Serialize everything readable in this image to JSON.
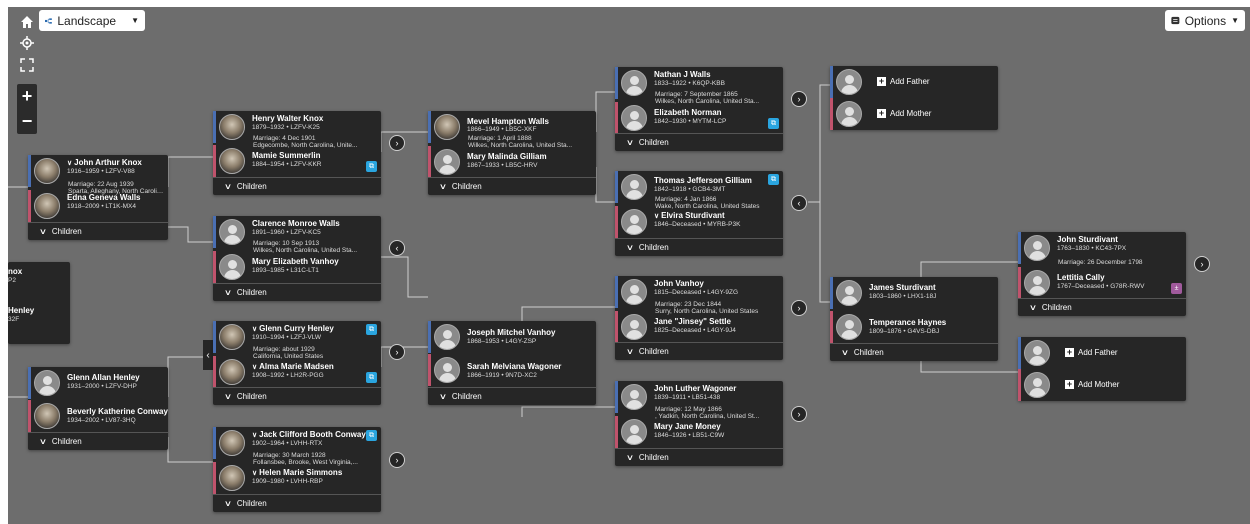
{
  "toolbar": {
    "layout_label": "Landscape",
    "options_label": "Options",
    "home_icon": "home-icon",
    "locate_icon": "crosshair-icon",
    "fullscreen_icon": "fullscreen-icon",
    "zoom_in": "+",
    "zoom_out": "−"
  },
  "common": {
    "children": "Children",
    "add_father": "Add Father",
    "add_mother": "Add Mother"
  },
  "partial": {
    "n1": "nox",
    "n1b": "P2",
    "n2": "Henley",
    "n2b": "32F"
  },
  "fam_knox": {
    "h_name": "John Arthur Knox",
    "h_dates": "1916–1959 • LZFV-V88",
    "marriage": "Marriage: 22 Aug 1939",
    "place": "Sparta, Alleghany, North Carolina,...",
    "w_name": "Edna Geneva Walls",
    "w_dates": "1918–2009 • LT1K-MX4"
  },
  "fam_henley": {
    "h_name": "Glenn Allan Henley",
    "h_dates": "1931–2000 • LZFV-DHP",
    "w_name": "Beverly Katherine Conway",
    "w_dates": "1934–2002 • LV87-3HQ"
  },
  "fam_hwknox": {
    "h_name": "Henry Walter Knox",
    "h_dates": "1879–1932 • LZFV-K25",
    "marriage": "Marriage: 4 Dec 1901",
    "place": "Edgecombe, North Carolina, Unite...",
    "w_name": "Mamie Summerlin",
    "w_dates": "1884–1954 • LZFV-KKR"
  },
  "fam_cmwalls": {
    "h_name": "Clarence Monroe Walls",
    "h_dates": "1891–1960 • LZFV-KC5",
    "marriage": "Marriage: 10 Sep 1913",
    "place": "Wilkes, North Carolina, United Sta...",
    "w_name": "Mary Elizabeth Vanhoy",
    "w_dates": "1893–1985 • L31C-LT1"
  },
  "fam_gchenley": {
    "h_name": "Glenn Curry Henley",
    "h_dates": "1910–1994 • LZFJ-VLW",
    "marriage": "Marriage: about 1929",
    "place": "California, United States",
    "w_name": "Alma Marie Madsen",
    "w_dates": "1908–1992 • LH2R-PGG"
  },
  "fam_jcconway": {
    "h_name": "Jack Clifford Booth Conway",
    "h_dates": "1902–1964 • LVHH-RTX",
    "marriage": "Marriage: 30 March 1928",
    "place": "Follansbee, Brooke, West Virginia,...",
    "w_name": "Helen Marie Simmons",
    "w_dates": "1909–1980 • LVHH-RBP"
  },
  "fam_mhwalls": {
    "h_name": "Mevel Hampton Walls",
    "h_dates": "1866–1949 • LB5C-XKF",
    "marriage": "Marriage: 1 April 1888",
    "place": "Wilkes, North Carolina, United Sta...",
    "w_name": "Mary Malinda Gilliam",
    "w_dates": "1867–1933 • LB5C-HRV"
  },
  "fam_jmvanhoy": {
    "h_name": "Joseph Mitchel Vanhoy",
    "h_dates": "1868–1953 • L4GY-ZSP",
    "w_name": "Sarah Melviana Wagoner",
    "w_dates": "1866–1919 • 9N7D-XC2"
  },
  "fam_njwalls": {
    "h_name": "Nathan J Walls",
    "h_dates": "1833–1922 • K6QP-KBB",
    "marriage": "Marriage: 7 September 1865",
    "place": "Wilkes, North Carolina, United Sta...",
    "w_name": "Elizabeth Norman",
    "w_dates": "1842–1930 • MYTM-LCP"
  },
  "fam_tjgilliam": {
    "h_name": "Thomas Jefferson Gilliam",
    "h_dates": "1842–1918 • GCB4-3MT",
    "marriage": "Marriage: 4 Jan 1866",
    "place": "Wake, North Carolina, United States",
    "w_name": "Elvira Sturdivant",
    "w_dates": "1846–Deceased • MYRB-P3K"
  },
  "fam_jvanhoy": {
    "h_name": "John Vanhoy",
    "h_dates": "1815–Deceased • L4GY-9ZG",
    "marriage": "Marriage: 23 Dec 1844",
    "place": "Surry, North Carolina, United States",
    "w_name": "Jane \"Jinsey\" Settle",
    "w_dates": "1825–Deceased • L4GY-9J4"
  },
  "fam_jlwagoner": {
    "h_name": "John Luther Wagoner",
    "h_dates": "1839–1911 • LB51-438",
    "marriage": "Marriage: 12 May 1866",
    "place": ", Yadkin, North Carolina, United St...",
    "w_name": "Mary Jane Money",
    "w_dates": "1846–1926 • LB51-C9W"
  },
  "fam_jsturdivant": {
    "h_name": "James Sturdivant",
    "h_dates": "1803–1860 • LHX1-18J",
    "w_name": "Temperance Haynes",
    "w_dates": "1809–1876 • G4VS-DBJ"
  },
  "fam_josturdivant": {
    "h_name": "John Sturdivant",
    "h_dates": "1763–1830 • KC43-7PX",
    "marriage": "Marriage: 26 December 1798",
    "w_name": "Lettitia Cally",
    "w_dates": "1767–Deceased • G78R-RWV"
  }
}
